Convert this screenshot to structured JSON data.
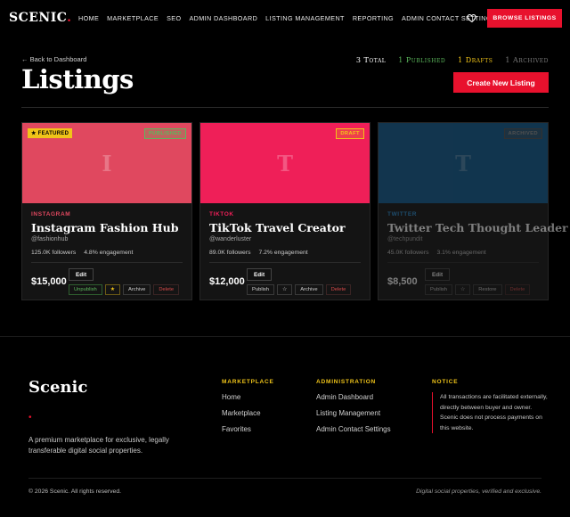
{
  "nav": {
    "logo": "SCENIC",
    "logo_dot": ".",
    "links": [
      "HOME",
      "MARKETPLACE",
      "SEO",
      "ADMIN DASHBOARD",
      "LISTING MANAGEMENT",
      "REPORTING",
      "ADMIN CONTACT SETTINGS"
    ],
    "browse_label": "BROWSE LISTINGS"
  },
  "header": {
    "back_label": "← Back to Dashboard",
    "title": "Listings",
    "stats": {
      "total": "3 Total",
      "published": "1 Published",
      "drafts": "1 Drafts",
      "archived": "1 Archived"
    },
    "create_label": "Create New Listing"
  },
  "cards": [
    {
      "initial": "I",
      "banner_color": "#e0485f",
      "featured": "★ FEATURED",
      "status": "PUBLISHED",
      "platform": "INSTAGRAM",
      "platform_color": "#e0485f",
      "title": "Instagram Fashion Hub",
      "handle": "@fashionhub",
      "followers": "125.0K followers",
      "engagement": "4.8% engagement",
      "price": "$15,000",
      "edit": "Edit",
      "actions": [
        "Unpublish",
        "★",
        "Archive",
        "Delete"
      ]
    },
    {
      "initial": "T",
      "banner_color": "#ef1f58",
      "featured": "",
      "status": "DRAFT",
      "platform": "TIKTOK",
      "platform_color": "#ef1f58",
      "title": "TikTok Travel Creator",
      "handle": "@wanderluster",
      "followers": "89.0K followers",
      "engagement": "7.2% engagement",
      "price": "$12,000",
      "edit": "Edit",
      "actions": [
        "Publish",
        "☆",
        "Archive",
        "Delete"
      ]
    },
    {
      "initial": "T",
      "banner_color": "#0f5e94",
      "featured": "",
      "status": "ARCHIVED",
      "platform": "TWITTER",
      "platform_color": "#2a8fd4",
      "title": "Twitter Tech Thought Leader",
      "handle": "@techpundit",
      "followers": "45.0K followers",
      "engagement": "3.1% engagement",
      "price": "$8,500",
      "edit": "Edit",
      "actions": [
        "Publish",
        "☆",
        "Restore",
        "Delete"
      ]
    }
  ],
  "footer": {
    "logo": "Scenic",
    "dot": "•",
    "description": "A premium marketplace for exclusive, legally transferable digital social properties.",
    "marketplace": {
      "heading": "MARKETPLACE",
      "items": [
        "Home",
        "Marketplace",
        "Favorites"
      ]
    },
    "administration": {
      "heading": "ADMINISTRATION",
      "items": [
        "Admin Dashboard",
        "Listing Management",
        "Admin Contact Settings"
      ]
    },
    "notice": {
      "heading": "NOTICE",
      "text": "All transactions are facilitated externally, directly between buyer and owner. Scenic does not process payments on this website."
    },
    "copyright": "© 2026 Scenic. All rights reserved.",
    "tagline": "Digital social properties, verified and exclusive."
  },
  "colors": {
    "accent": "#e8112d",
    "gold": "#f0c419",
    "published": "#5cb85c",
    "archived": "#7a7a7a"
  }
}
